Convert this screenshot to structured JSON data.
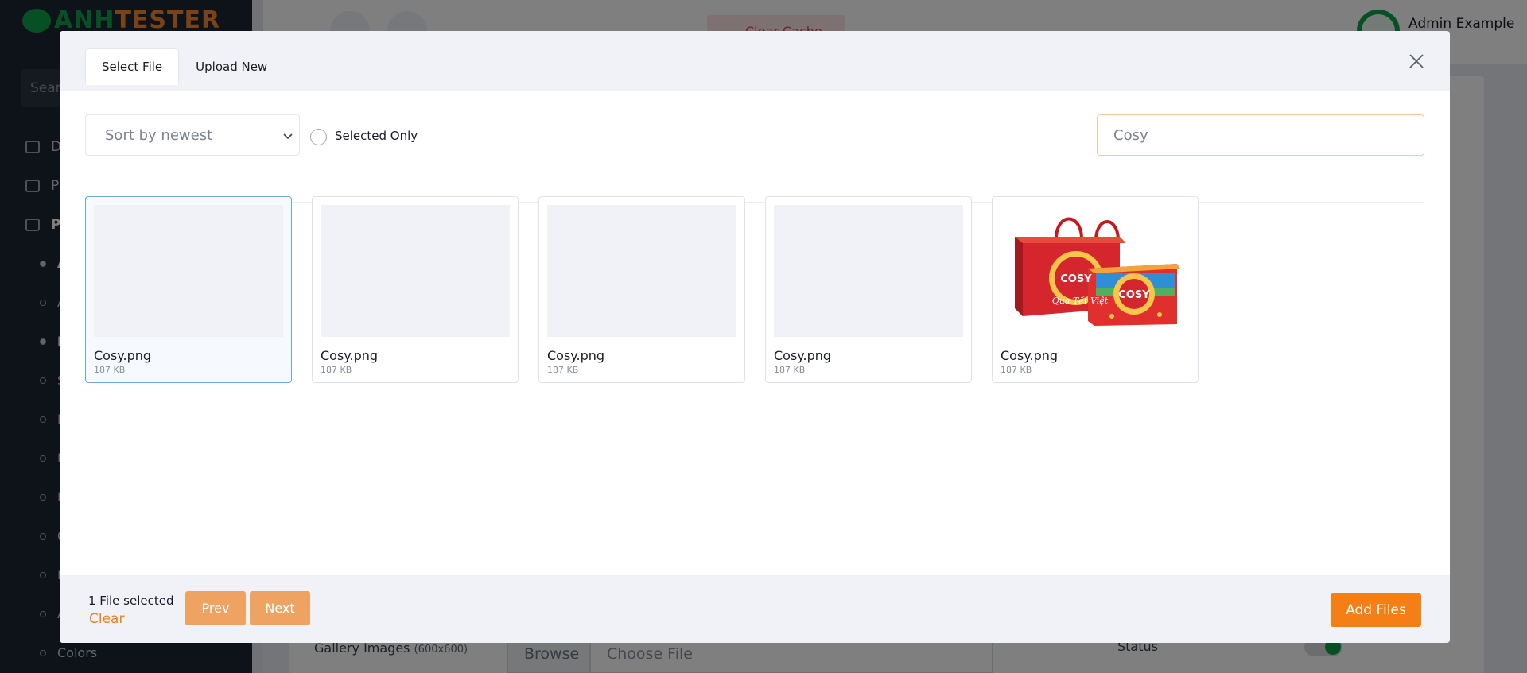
{
  "background": {
    "logo": {
      "part1": "ANH",
      "part2": "TESTER"
    },
    "search_placeholder": "Sear",
    "nav_items": [
      "Do",
      "PO",
      "Pr",
      "A",
      "A",
      "In",
      "S",
      "D",
      "B",
      "B",
      "C",
      "B",
      "A",
      "Colors"
    ],
    "clear_cache": "Clear Cache",
    "admin_name": "Admin Example",
    "gallery_label": "Gallery Images",
    "gallery_hint": "(600x600)",
    "browse": "Browse",
    "choose_file": "Choose File",
    "status_label": "Status"
  },
  "modal": {
    "tabs": [
      {
        "label": "Select File"
      },
      {
        "label": "Upload New"
      }
    ],
    "sort": {
      "selected": "Sort by newest"
    },
    "selected_only_label": "Selected Only",
    "search": {
      "value": "Cosy"
    },
    "files": [
      {
        "name": "Cosy.png",
        "size": "187 KB",
        "selected": true,
        "has_preview": false
      },
      {
        "name": "Cosy.png",
        "size": "187 KB",
        "selected": false,
        "has_preview": false
      },
      {
        "name": "Cosy.png",
        "size": "187 KB",
        "selected": false,
        "has_preview": false
      },
      {
        "name": "Cosy.png",
        "size": "187 KB",
        "selected": false,
        "has_preview": false
      },
      {
        "name": "Cosy.png",
        "size": "187 KB",
        "selected": false,
        "has_preview": true
      }
    ],
    "footer": {
      "selected_count": "1 File selected",
      "clear": "Clear",
      "prev": "Prev",
      "next": "Next",
      "add_files": "Add Files"
    }
  },
  "colors": {
    "accent": "#f57f17",
    "pager": "#eea362",
    "selected_border": "#6fa6dc"
  },
  "preview_art": {
    "brand": "COSY",
    "script": "Qua Tết Việt"
  }
}
